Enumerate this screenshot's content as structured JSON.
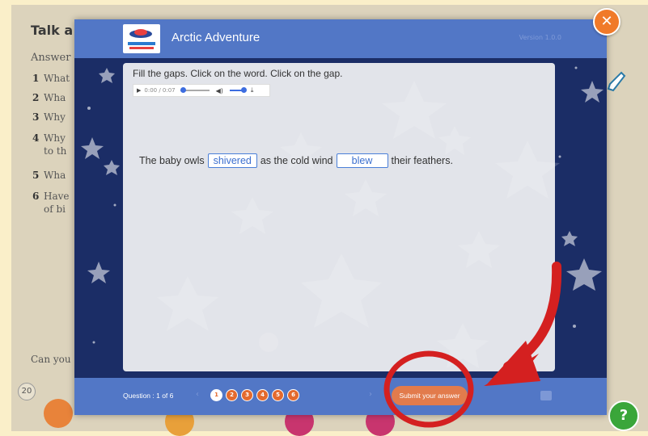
{
  "book": {
    "title": "Talk a",
    "subtitle": "Answer",
    "questions": [
      {
        "num": "1",
        "text": "What"
      },
      {
        "num": "2",
        "text": "Wha"
      },
      {
        "num": "3",
        "text": "Why"
      },
      {
        "num": "4",
        "text": "Why"
      },
      {
        "num": "",
        "text": "to th"
      },
      {
        "num": "5",
        "text": "Wha"
      },
      {
        "num": "6",
        "text": "Have"
      },
      {
        "num": "",
        "text": "of bi"
      }
    ],
    "footer_text": "Can you",
    "page_number": "20"
  },
  "modal": {
    "title": "Arctic Adventure",
    "version": "Version 1.0.0",
    "close_icon": "close-icon",
    "instructions": "Fill the gaps. Click on the word. Click on the gap.",
    "audio": {
      "time": "0:00 / 0:07",
      "play_icon": "play-icon",
      "volume_icon": "volume-icon",
      "download_icon": "download-icon"
    },
    "sentence": {
      "part1": "The baby owls",
      "gap1": "shivered",
      "part2": "as the cold wind",
      "gap2": "blew",
      "part3": "their feathers."
    },
    "footer": {
      "question_counter": "Question : 1 of 6",
      "question_numbers": [
        "1",
        "2",
        "3",
        "4",
        "5",
        "6"
      ],
      "current_question": 1,
      "submit_label": "Submit your answer"
    }
  },
  "colors": {
    "modal_header": "#5277c6",
    "modal_bg": "#1b2d66",
    "accent_orange": "#e46a2e",
    "gap_blue": "#3b6fcf",
    "annotation_red": "#d42020"
  }
}
